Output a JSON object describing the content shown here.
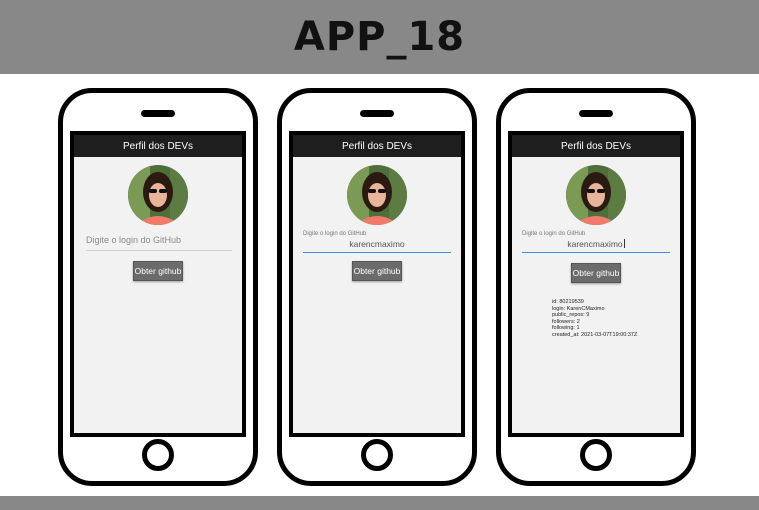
{
  "banner": {
    "title": "APP_18"
  },
  "phones": [
    {
      "appbar_title": "Perfil dos DEVs",
      "input_placeholder": "Digite o login do GitHub",
      "button_label": "Obter github"
    },
    {
      "appbar_title": "Perfil dos DEVs",
      "input_label": "Digite o login do GitHub",
      "input_value": "karencmaximo",
      "button_label": "Obter github"
    },
    {
      "appbar_title": "Perfil dos DEVs",
      "input_label": "Digite o login do GitHub",
      "input_value": "karencmaximo",
      "button_label": "Obter github",
      "result": [
        "id: 80219539",
        "login: KarenCMaximo",
        "public_repos: 9",
        "followers: 2",
        "following: 1",
        "created_at: 2021-03-07T19:00:37Z"
      ]
    }
  ],
  "colors": {
    "banner_bg": "#888888",
    "appbar_bg": "#1e1e1e",
    "button_bg": "#6b6b6b",
    "focus_underline": "#3d8ee8"
  },
  "icons": {
    "avatar": "profile-photo"
  }
}
